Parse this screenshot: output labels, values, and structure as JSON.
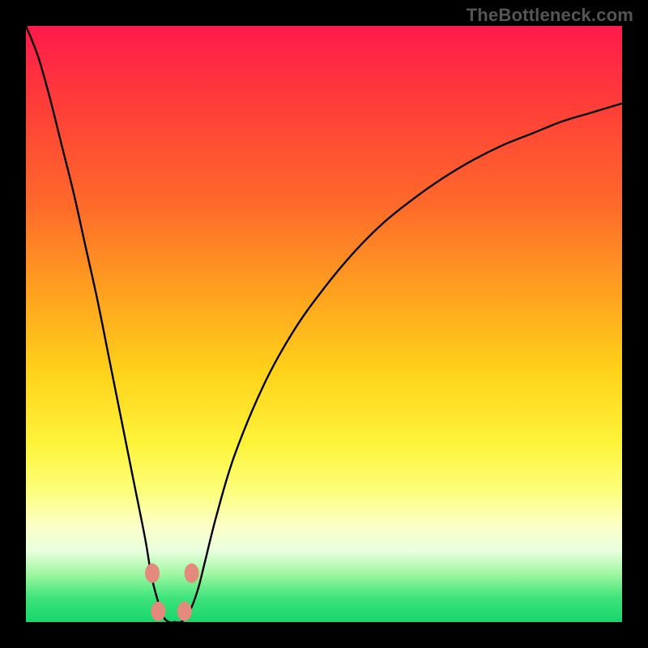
{
  "attribution": "TheBottleneck.com",
  "chart_data": {
    "type": "line",
    "title": "",
    "xlabel": "",
    "ylabel": "",
    "xlim": [
      0,
      100
    ],
    "ylim": [
      0,
      100
    ],
    "series": [
      {
        "name": "bottleneck-curve",
        "x": [
          0,
          2,
          4,
          6,
          8,
          10,
          12,
          14,
          16,
          18,
          20,
          21,
          22,
          23,
          24,
          25,
          26,
          27,
          28,
          29,
          30,
          32,
          35,
          40,
          45,
          50,
          55,
          60,
          65,
          70,
          75,
          80,
          85,
          90,
          95,
          100
        ],
        "values": [
          100,
          95,
          88,
          80,
          72,
          63,
          54,
          44,
          34,
          24,
          14,
          8,
          4,
          1,
          0,
          0,
          0,
          1,
          3,
          6,
          10,
          18,
          28,
          40,
          49,
          56,
          62,
          67,
          71,
          74.5,
          77.5,
          80,
          82,
          84,
          85.5,
          87
        ]
      }
    ],
    "markers": [
      {
        "name": "marker-left-upper",
        "x": 21.2,
        "y": 8.2
      },
      {
        "name": "marker-left-lower",
        "x": 22.2,
        "y": 1.8
      },
      {
        "name": "marker-right-lower",
        "x": 26.6,
        "y": 1.8
      },
      {
        "name": "marker-right-upper",
        "x": 27.8,
        "y": 8.2
      }
    ],
    "marker_color": "#e38a7d",
    "curve_color": "#000000"
  }
}
